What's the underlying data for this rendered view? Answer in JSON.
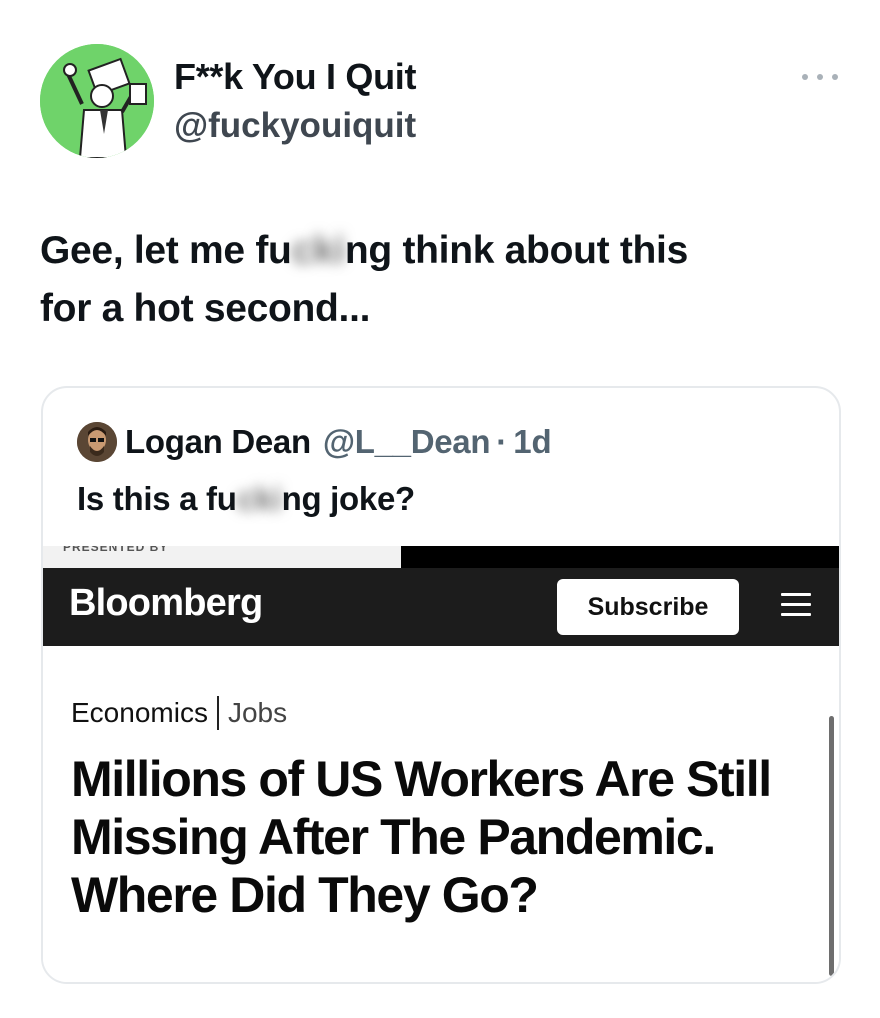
{
  "tweet": {
    "display_name": "F**k You I Quit",
    "handle": "@fuckyouiquit",
    "text_line1_before": "Gee, let me fu",
    "text_line1_blur": "cki",
    "text_line1_after": "ng think about this",
    "text_line2": "for a hot second..."
  },
  "quote": {
    "name": "Logan Dean",
    "handle": "@L__Dean",
    "separator": "·",
    "time": "1d",
    "text_before": "Is this a fu",
    "text_blur": "cki",
    "text_after": "ng joke?"
  },
  "embed": {
    "brand": "Bloomberg",
    "subscribe_label": "Subscribe",
    "ad_label": "PRESENTED BY",
    "category": "Economics",
    "subcategory": "Jobs",
    "headline": "Millions of US Workers Are Still Missing After The Pandemic. Where Did They Go?"
  },
  "icons": {
    "more": "more-horizontal-icon",
    "menu": "hamburger-menu-icon"
  },
  "colors": {
    "avatar_bg": "#6fd36a",
    "bloomberg_bar": "#1c1c1c",
    "muted_text": "#536471"
  }
}
